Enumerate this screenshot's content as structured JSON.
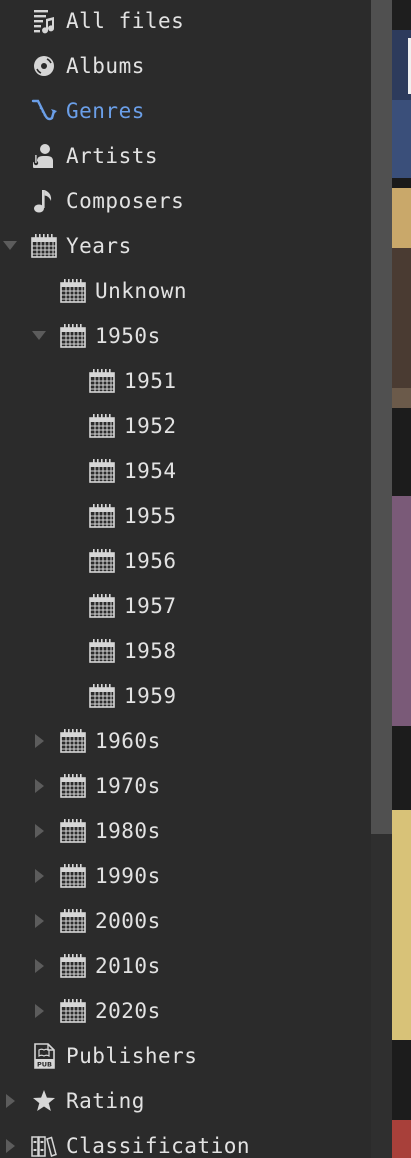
{
  "tree": {
    "items": [
      {
        "label": "All files",
        "icon": "music-files-icon",
        "depth": 0,
        "expander": "none",
        "active": false
      },
      {
        "label": "Albums",
        "icon": "disc-icon",
        "depth": 0,
        "expander": "none",
        "active": false
      },
      {
        "label": "Genres",
        "icon": "saxophone-icon",
        "depth": 0,
        "expander": "none",
        "active": true
      },
      {
        "label": "Artists",
        "icon": "artist-icon",
        "depth": 0,
        "expander": "none",
        "active": false
      },
      {
        "label": "Composers",
        "icon": "music-note-icon",
        "depth": 0,
        "expander": "none",
        "active": false
      },
      {
        "label": "Years",
        "icon": "calendar-icon",
        "depth": 0,
        "expander": "expanded",
        "active": false
      },
      {
        "label": "Unknown",
        "icon": "calendar-icon",
        "depth": 1,
        "expander": "none",
        "active": false
      },
      {
        "label": "1950s",
        "icon": "calendar-icon",
        "depth": 1,
        "expander": "expanded",
        "active": false
      },
      {
        "label": "1951",
        "icon": "calendar-icon",
        "depth": 2,
        "expander": "none",
        "active": false
      },
      {
        "label": "1952",
        "icon": "calendar-icon",
        "depth": 2,
        "expander": "none",
        "active": false
      },
      {
        "label": "1954",
        "icon": "calendar-icon",
        "depth": 2,
        "expander": "none",
        "active": false
      },
      {
        "label": "1955",
        "icon": "calendar-icon",
        "depth": 2,
        "expander": "none",
        "active": false
      },
      {
        "label": "1956",
        "icon": "calendar-icon",
        "depth": 2,
        "expander": "none",
        "active": false
      },
      {
        "label": "1957",
        "icon": "calendar-icon",
        "depth": 2,
        "expander": "none",
        "active": false
      },
      {
        "label": "1958",
        "icon": "calendar-icon",
        "depth": 2,
        "expander": "none",
        "active": false
      },
      {
        "label": "1959",
        "icon": "calendar-icon",
        "depth": 2,
        "expander": "none",
        "active": false
      },
      {
        "label": "1960s",
        "icon": "calendar-icon",
        "depth": 1,
        "expander": "collapsed",
        "active": false
      },
      {
        "label": "1970s",
        "icon": "calendar-icon",
        "depth": 1,
        "expander": "collapsed",
        "active": false
      },
      {
        "label": "1980s",
        "icon": "calendar-icon",
        "depth": 1,
        "expander": "collapsed",
        "active": false
      },
      {
        "label": "1990s",
        "icon": "calendar-icon",
        "depth": 1,
        "expander": "collapsed",
        "active": false
      },
      {
        "label": "2000s",
        "icon": "calendar-icon",
        "depth": 1,
        "expander": "collapsed",
        "active": false
      },
      {
        "label": "2010s",
        "icon": "calendar-icon",
        "depth": 1,
        "expander": "collapsed",
        "active": false
      },
      {
        "label": "2020s",
        "icon": "calendar-icon",
        "depth": 1,
        "expander": "collapsed",
        "active": false
      },
      {
        "label": "Publishers",
        "icon": "publisher-icon",
        "depth": 0,
        "expander": "none",
        "active": false
      },
      {
        "label": "Rating",
        "icon": "star-icon",
        "depth": 0,
        "expander": "collapsed",
        "active": false
      },
      {
        "label": "Classification",
        "icon": "books-icon",
        "depth": 0,
        "expander": "collapsed",
        "active": false
      }
    ]
  },
  "colors": {
    "background": "#2b2b2b",
    "text": "#e2e2e2",
    "active_text": "#6b9fe8",
    "expander": "#5c5c5c",
    "scroll_thumb": "#505050"
  }
}
